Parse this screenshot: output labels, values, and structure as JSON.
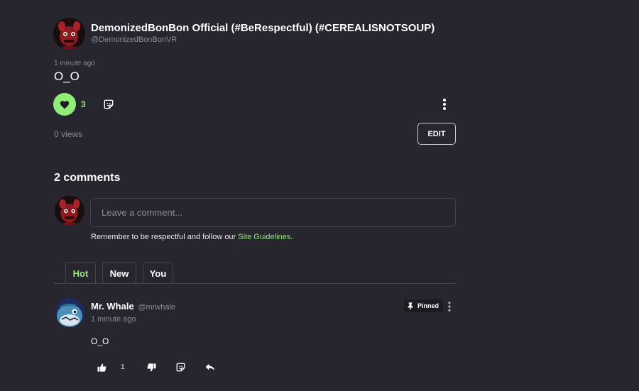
{
  "post": {
    "author_name": "DemonizedBonBon Official (#BeRespectful) (#CEREALISNOTSOUP)",
    "author_handle": "@DemonizedBonBonVR",
    "timestamp": "1 minute ago",
    "text": "O_O",
    "like_count": "3",
    "views": "0 views",
    "edit_label": "EDIT"
  },
  "comments": {
    "title": "2 comments",
    "input_placeholder": "Leave a comment...",
    "guidelines_prefix": "Remember to be respectful and follow our ",
    "guidelines_link": "Site Guidelines",
    "guidelines_suffix": ".",
    "tabs": [
      {
        "label": "Hot",
        "active": true
      },
      {
        "label": "New",
        "active": false
      },
      {
        "label": "You",
        "active": false
      }
    ],
    "items": [
      {
        "name": "Mr. Whale",
        "handle": "@mrwhale",
        "time": "1 minute ago",
        "pinned_label": "Pinned",
        "text": "O_O",
        "like_count": "1"
      }
    ]
  },
  "colors": {
    "background": "#27262f",
    "accent": "#90ee78",
    "muted_text": "#8b8a94"
  },
  "icons": [
    "heart-icon",
    "sticker-icon",
    "more-vertical-icon",
    "pin-icon",
    "thumbs-up-icon",
    "thumbs-down-icon",
    "reply-icon"
  ]
}
